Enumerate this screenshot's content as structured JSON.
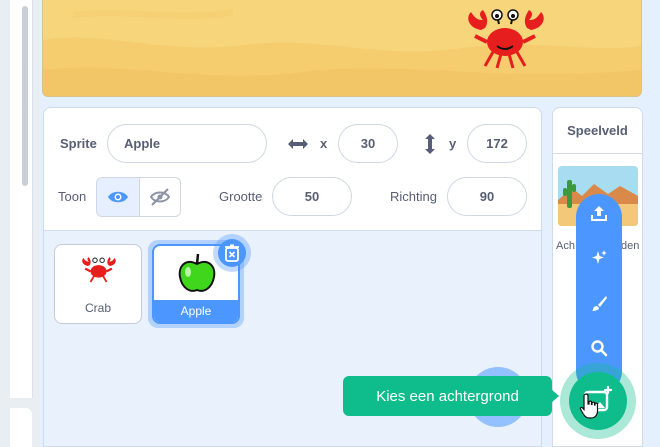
{
  "sprite_info": {
    "sprite_label": "Sprite",
    "sprite_name": "Apple",
    "x_label": "x",
    "x_value": "30",
    "y_label": "y",
    "y_value": "172",
    "show_label": "Toon",
    "size_label": "Grootte",
    "size_value": "50",
    "direction_label": "Richting",
    "direction_value": "90"
  },
  "sprites": [
    {
      "name": "Crab",
      "selected": false
    },
    {
      "name": "Apple",
      "selected": true
    }
  ],
  "stage_pane": {
    "title": "Speelveld",
    "backdrop_label_partial": "Ach",
    "backdrop_label_partial_end": "den"
  },
  "tooltip": {
    "text": "Kies een achtergrond"
  },
  "backdrop_menu": {
    "items": [
      "upload-icon",
      "surprise-icon",
      "paint-icon",
      "search-icon"
    ]
  },
  "colors": {
    "accent_blue": "#4c97ff",
    "green": "#0fbd8c",
    "text": "#575e75"
  }
}
